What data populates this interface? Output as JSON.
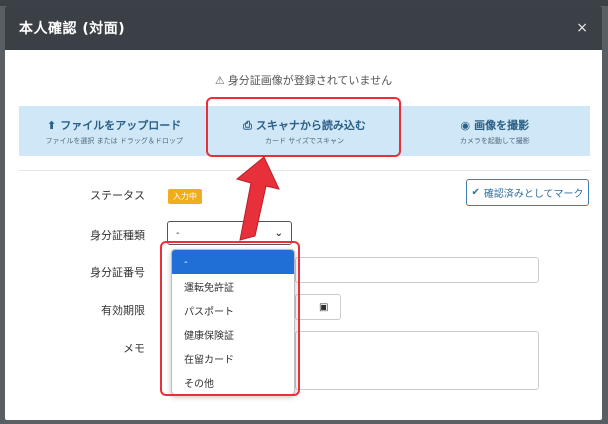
{
  "modal": {
    "title": "本人確認 (対面)",
    "close": "×"
  },
  "notice": {
    "icon": "⚠",
    "text": "身分証画像が登録されていません"
  },
  "upload_options": [
    {
      "icon": "⬆",
      "label": "ファイルをアップロード",
      "sub": "ファイルを選択 または ドラッグ＆ドロップ"
    },
    {
      "icon": "⎙",
      "label": "スキャナから読み込む",
      "sub": "カード サイズでスキャン"
    },
    {
      "icon": "◉",
      "label": "画像を撮影",
      "sub": "カメラを起動して撮影"
    }
  ],
  "form": {
    "status_label": "ステータス",
    "status_badge": "入力中",
    "mark_button_icon": "✔",
    "mark_button": "確認済みとしてマーク",
    "id_type_label": "身分証種類",
    "id_type_value": "-",
    "id_number_label": "身分証番号",
    "expiry_label": "有効期限",
    "memo_label": "メモ"
  },
  "dropdown_options": [
    "-",
    "運転免許証",
    "パスポート",
    "健康保険証",
    "在留カード",
    "その他"
  ],
  "colors": {
    "header_bg": "#3a4046",
    "upload_bg": "#cfe7f6",
    "selected_option": "#1f6fd6",
    "highlight": "#e8303a",
    "badge": "#f0ad1e"
  }
}
